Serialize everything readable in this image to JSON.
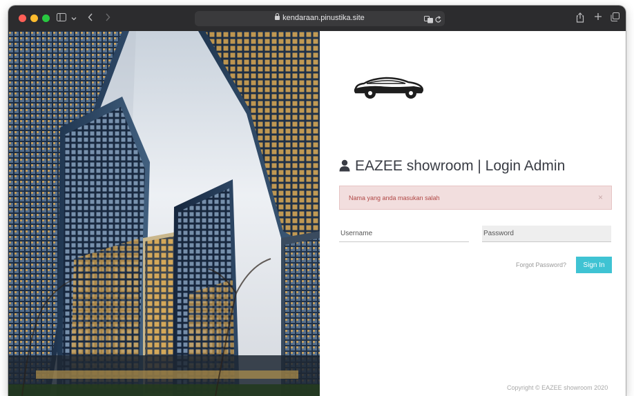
{
  "browser": {
    "url": "kendaraan.pinustika.site",
    "icons": {
      "sidebar": "sidebar-icon",
      "back": "chevron-left-icon",
      "forward": "chevron-right-icon",
      "translate": "translate-icon",
      "reload": "reload-icon",
      "share": "share-icon",
      "new_tab": "plus-icon",
      "tabs": "tabs-icon"
    }
  },
  "hero": {
    "image": "low-angle view of glass skyscrapers"
  },
  "login": {
    "title": "EAZEE showroom | Login Admin",
    "alert_message": "Nama yang anda masukan salah",
    "alert_close": "×",
    "username_placeholder": "Username",
    "password_placeholder": "Password",
    "forgot_label": "Forgot Password?",
    "signin_label": "Sign In",
    "copyright": "Copyright © EAZEE showroom 2020"
  },
  "colors": {
    "accent": "#3fc3d3",
    "alert_bg": "#f2dede",
    "alert_text": "#b04745",
    "titlebar": "#2c2c2e"
  }
}
